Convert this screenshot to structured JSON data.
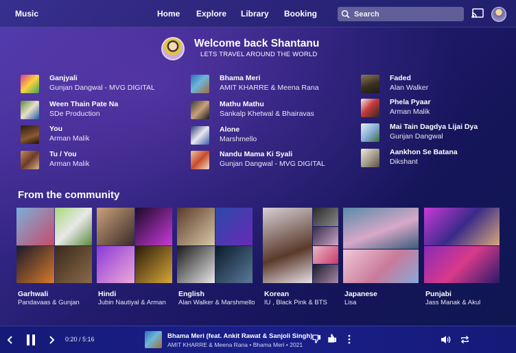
{
  "header": {
    "brand": "Music",
    "nav": [
      "Home",
      "Explore",
      "Library",
      "Booking"
    ],
    "search_placeholder": "Search"
  },
  "welcome": {
    "title": "Welcome back Shantanu",
    "subtitle": "LETS TRAVEL AROUND THE WORLD"
  },
  "quick_picks": [
    {
      "title": "Ganjyali",
      "artist": "Gunjan Dangwal - MVG DIGITAL"
    },
    {
      "title": "Ween Thain Pate Na",
      "artist": "SDe Production"
    },
    {
      "title": "You",
      "artist": "Arman Malik"
    },
    {
      "title": "Tu / You",
      "artist": "Arman Malik"
    },
    {
      "title": "Bhama Meri",
      "artist": "AMIT KHARRE & Meena Rana"
    },
    {
      "title": "Mathu Mathu",
      "artist": "Sankalp Khetwal & Bhairavas"
    },
    {
      "title": "Alone",
      "artist": "Marshmello"
    },
    {
      "title": "Nandu Mama Ki Syali",
      "artist": "Gunjan Dangwal - MVG DIGITAL"
    },
    {
      "title": "Faded",
      "artist": "Alan Walker"
    },
    {
      "title": "Phela Pyaar",
      "artist": "Arman Malik"
    },
    {
      "title": "Mai Tain Dagdya Lijai Dya",
      "artist": "Gunjan Dangwal"
    },
    {
      "title": "Aankhon Se Batana",
      "artist": "Dikshant"
    }
  ],
  "community": {
    "title": "From the community",
    "cards": [
      {
        "name": "Garhwali",
        "by": "Pandavaas & Gunjan"
      },
      {
        "name": "Hindi",
        "by": "Jubin Nautiyal & Arman"
      },
      {
        "name": "English",
        "by": "Alan Walker & Marshmello"
      },
      {
        "name": "Korean",
        "by": "IU , Black Pink & BTS"
      },
      {
        "name": "Japanese",
        "by": "Lisa"
      },
      {
        "name": "Punjabi",
        "by": "Jass Manak & Akul"
      }
    ]
  },
  "player": {
    "time": "0:20 / 5:16",
    "title": "Bhama Meri (feat. Ankit Rawat & Sanjoli Singh)",
    "meta": "AMIT KHARRE & Meena Rana • Bhama Meri • 2021"
  },
  "colors": {
    "background_top": "#4a3aa8",
    "background_bottom": "#0e1650",
    "player_bar": "#1a1f8a"
  },
  "icons": [
    "search-icon",
    "cast-icon",
    "previous-icon",
    "pause-icon",
    "next-icon",
    "thumbs-down-icon",
    "thumbs-up-icon",
    "more-icon",
    "volume-icon",
    "repeat-icon"
  ]
}
